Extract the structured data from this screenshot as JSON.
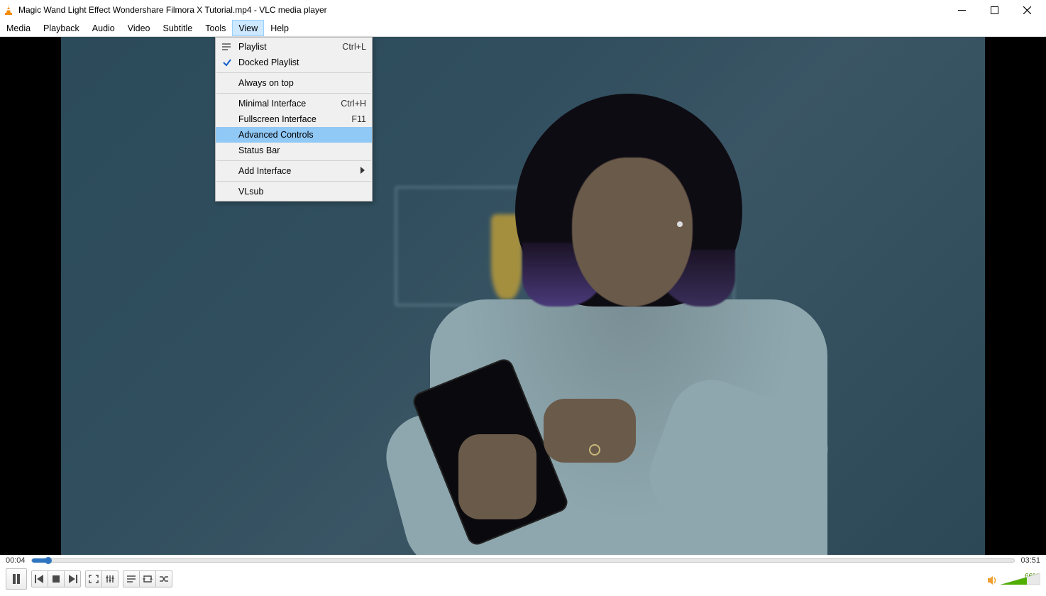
{
  "window": {
    "title": "Magic Wand Light Effect  Wondershare Filmora X Tutorial.mp4 - VLC media player"
  },
  "menubar": {
    "items": [
      "Media",
      "Playback",
      "Audio",
      "Video",
      "Subtitle",
      "Tools",
      "View",
      "Help"
    ],
    "open_index": 6
  },
  "view_menu": {
    "items": [
      {
        "label": "Playlist",
        "shortcut": "Ctrl+L",
        "icon": "list",
        "checked": false
      },
      {
        "label": "Docked Playlist",
        "shortcut": "",
        "icon": "",
        "checked": true
      },
      {
        "separator": true
      },
      {
        "label": "Always on top",
        "shortcut": "",
        "icon": "",
        "checked": false
      },
      {
        "separator": true
      },
      {
        "label": "Minimal Interface",
        "shortcut": "Ctrl+H",
        "icon": "",
        "checked": false
      },
      {
        "label": "Fullscreen Interface",
        "shortcut": "F11",
        "icon": "",
        "checked": false
      },
      {
        "label": "Advanced Controls",
        "shortcut": "",
        "icon": "",
        "checked": false,
        "highlight": true
      },
      {
        "label": "Status Bar",
        "shortcut": "",
        "icon": "",
        "checked": false
      },
      {
        "separator": true
      },
      {
        "label": "Add Interface",
        "shortcut": "",
        "icon": "",
        "submenu": true
      },
      {
        "separator": true
      },
      {
        "label": "VLsub",
        "shortcut": "",
        "icon": "",
        "checked": false
      }
    ]
  },
  "playback": {
    "elapsed": "00:04",
    "total": "03:51",
    "progress_percent": 1.7
  },
  "volume": {
    "percent_label": "66%",
    "percent": 66
  }
}
